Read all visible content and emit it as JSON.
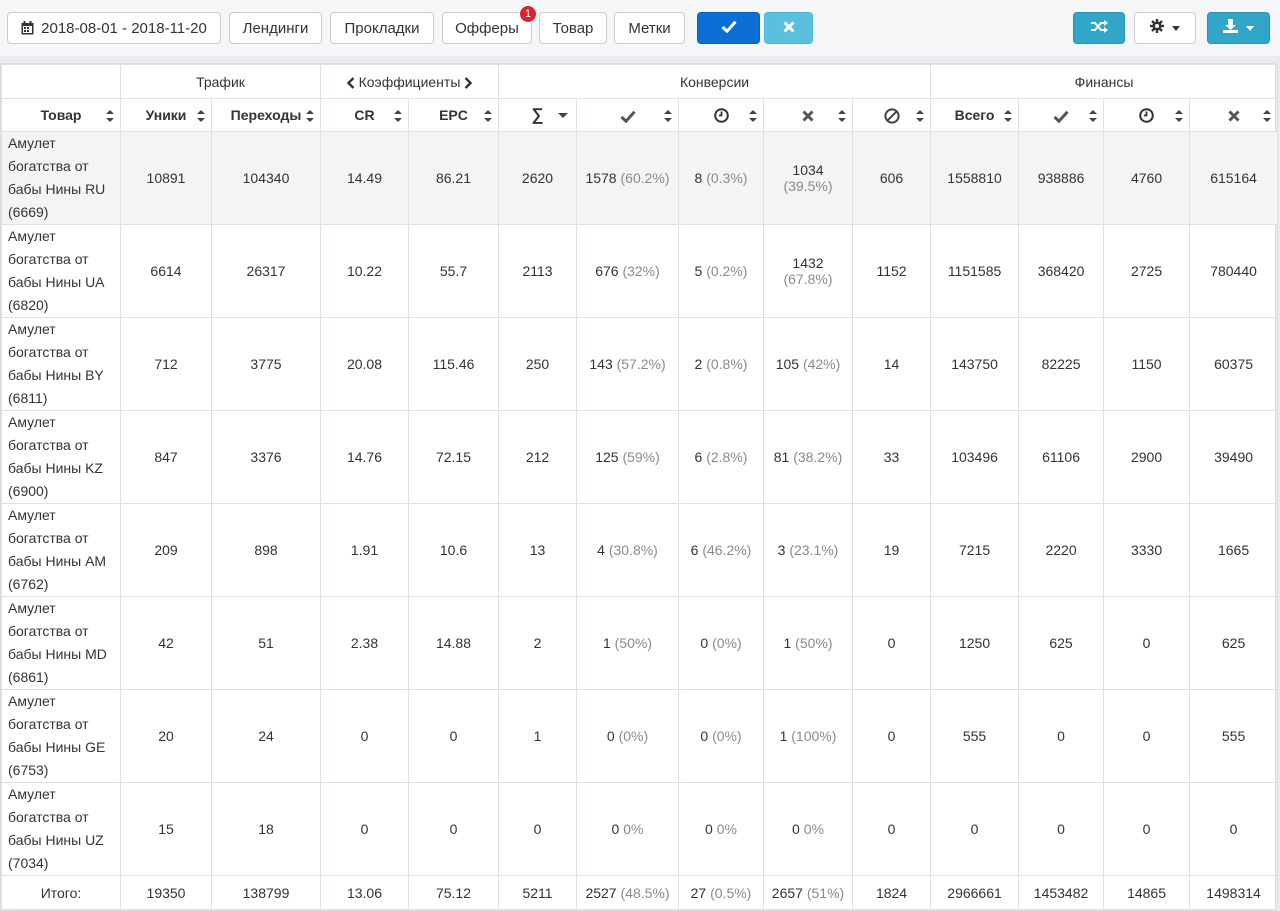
{
  "toolbar": {
    "date_range": "2018-08-01 - 2018-11-20",
    "landings": "Лендинги",
    "prelandings": "Прокладки",
    "offers": "Офферы",
    "offers_badge": "1",
    "product": "Товар",
    "tags": "Метки"
  },
  "groups": {
    "traffic": "Трафик",
    "coefficients": "Коэффициенты",
    "conversions": "Конверсии",
    "finances": "Финансы"
  },
  "columns": {
    "product": "Товар",
    "uniques": "Уники",
    "clicks": "Переходы",
    "cr": "CR",
    "epc": "EPC",
    "sum": "∑",
    "total": "Всего"
  },
  "rows": [
    {
      "name": "Амулет богатства от бабы Нины RU (6669)",
      "uniques": "10891",
      "clicks": "104340",
      "cr": "14.49",
      "epc": "86.21",
      "sum": "2620",
      "approved": "1578",
      "approved_pct": "(60.2%)",
      "hold": "8",
      "hold_pct": "(0.3%)",
      "rejected": "1034",
      "rejected_pct": "(39.5%)",
      "trash": "606",
      "fin_total": "1558810",
      "fin_approved": "938886",
      "fin_hold": "4760",
      "fin_rejected": "615164"
    },
    {
      "name": "Амулет богатства от бабы Нины UA (6820)",
      "uniques": "6614",
      "clicks": "26317",
      "cr": "10.22",
      "epc": "55.7",
      "sum": "2113",
      "approved": "676",
      "approved_pct": "(32%)",
      "hold": "5",
      "hold_pct": "(0.2%)",
      "rejected": "1432",
      "rejected_pct": "(67.8%)",
      "trash": "1152",
      "fin_total": "1151585",
      "fin_approved": "368420",
      "fin_hold": "2725",
      "fin_rejected": "780440"
    },
    {
      "name": "Амулет богатства от бабы Нины BY (6811)",
      "uniques": "712",
      "clicks": "3775",
      "cr": "20.08",
      "epc": "115.46",
      "sum": "250",
      "approved": "143",
      "approved_pct": "(57.2%)",
      "hold": "2",
      "hold_pct": "(0.8%)",
      "rejected": "105",
      "rejected_pct": "(42%)",
      "trash": "14",
      "fin_total": "143750",
      "fin_approved": "82225",
      "fin_hold": "1150",
      "fin_rejected": "60375"
    },
    {
      "name": "Амулет богатства от бабы Нины KZ (6900)",
      "uniques": "847",
      "clicks": "3376",
      "cr": "14.76",
      "epc": "72.15",
      "sum": "212",
      "approved": "125",
      "approved_pct": "(59%)",
      "hold": "6",
      "hold_pct": "(2.8%)",
      "rejected": "81",
      "rejected_pct": "(38.2%)",
      "trash": "33",
      "fin_total": "103496",
      "fin_approved": "61106",
      "fin_hold": "2900",
      "fin_rejected": "39490"
    },
    {
      "name": "Амулет богатства от бабы Нины AM (6762)",
      "uniques": "209",
      "clicks": "898",
      "cr": "1.91",
      "epc": "10.6",
      "sum": "13",
      "approved": "4",
      "approved_pct": "(30.8%)",
      "hold": "6",
      "hold_pct": "(46.2%)",
      "rejected": "3",
      "rejected_pct": "(23.1%)",
      "trash": "19",
      "fin_total": "7215",
      "fin_approved": "2220",
      "fin_hold": "3330",
      "fin_rejected": "1665"
    },
    {
      "name": "Амулет богатства от бабы Нины MD (6861)",
      "uniques": "42",
      "clicks": "51",
      "cr": "2.38",
      "epc": "14.88",
      "sum": "2",
      "approved": "1",
      "approved_pct": "(50%)",
      "hold": "0",
      "hold_pct": "(0%)",
      "rejected": "1",
      "rejected_pct": "(50%)",
      "trash": "0",
      "fin_total": "1250",
      "fin_approved": "625",
      "fin_hold": "0",
      "fin_rejected": "625"
    },
    {
      "name": "Амулет богатства от бабы Нины GE (6753)",
      "uniques": "20",
      "clicks": "24",
      "cr": "0",
      "epc": "0",
      "sum": "1",
      "approved": "0",
      "approved_pct": "(0%)",
      "hold": "0",
      "hold_pct": "(0%)",
      "rejected": "1",
      "rejected_pct": "(100%)",
      "trash": "0",
      "fin_total": "555",
      "fin_approved": "0",
      "fin_hold": "0",
      "fin_rejected": "555"
    },
    {
      "name": "Амулет богатства от бабы Нины UZ (7034)",
      "uniques": "15",
      "clicks": "18",
      "cr": "0",
      "epc": "0",
      "sum": "0",
      "approved": "0",
      "approved_pct": "0%",
      "hold": "0",
      "hold_pct": "0%",
      "rejected": "0",
      "rejected_pct": "0%",
      "trash": "0",
      "fin_total": "0",
      "fin_approved": "0",
      "fin_hold": "0",
      "fin_rejected": "0"
    }
  ],
  "totals": {
    "label": "Итого:",
    "uniques": "19350",
    "clicks": "138799",
    "cr": "13.06",
    "epc": "75.12",
    "sum": "5211",
    "approved": "2527",
    "approved_pct": "(48.5%)",
    "hold": "27",
    "hold_pct": "(0.5%)",
    "rejected": "2657",
    "rejected_pct": "(51%)",
    "trash": "1824",
    "fin_total": "2966661",
    "fin_approved": "1453482",
    "fin_hold": "14865",
    "fin_rejected": "1498314"
  },
  "icons": {
    "calendar": "calendar-icon",
    "check": "check-icon",
    "cross": "cross-icon",
    "clock": "clock-icon",
    "ban": "ban-icon",
    "shuffle": "shuffle-icon",
    "gear": "gear-icon",
    "download": "download-icon"
  },
  "colors": {
    "primary": "#0b6fd6",
    "info": "#5bc0de",
    "teal": "#31a6c8",
    "badge": "#e0222b"
  }
}
